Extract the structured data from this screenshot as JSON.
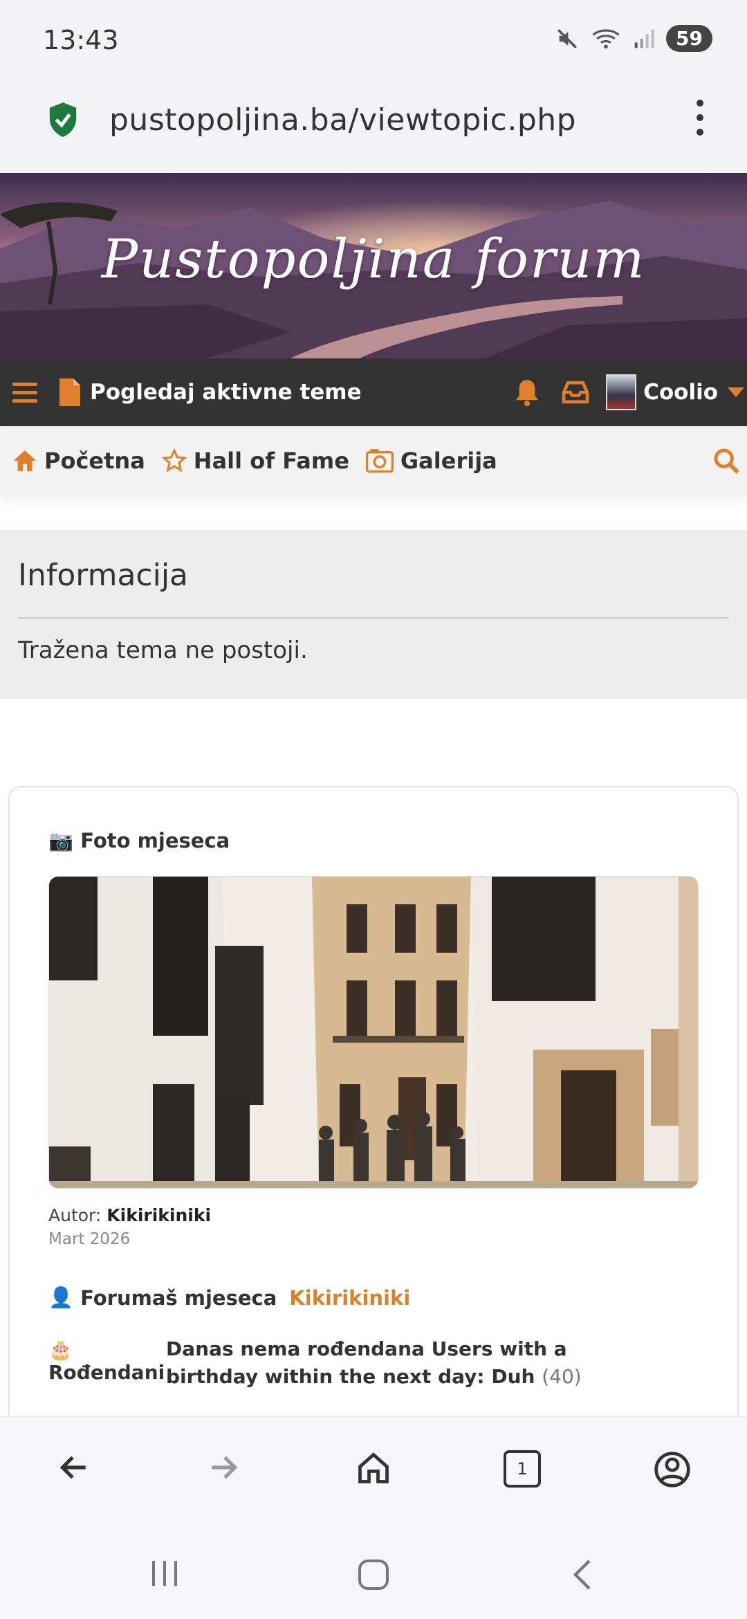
{
  "status_bar": {
    "time": "13:43",
    "battery": "59"
  },
  "url_bar": {
    "url": "pustopoljina.ba/viewtopic.php"
  },
  "banner": {
    "title": "Pustopoljina forum"
  },
  "navbar": {
    "active_topics": "Pogledaj aktivne teme",
    "username": "Coolio"
  },
  "subnav": {
    "items": [
      "Početna",
      "Hall of Fame",
      "Galerija"
    ]
  },
  "info": {
    "title": "Informacija",
    "message": "Tražena tema ne postoji."
  },
  "card": {
    "photo_heading": "Foto mjeseca",
    "author_label": "Autor:",
    "author": "Kikirikiniki",
    "date": "Mart 2026",
    "member_heading": "Forumaš mjeseca",
    "member_name": "Kikirikiniki",
    "birthday_label": "Rođendani",
    "birthday_text": "Danas nema rođendana Users with a birthday within the next day: Duh",
    "birthday_age": "(40)"
  },
  "browser_bar": {
    "tab_count": "1"
  },
  "colors": {
    "accent": "#e0802c",
    "navbar_bg": "#333333",
    "secure_green": "#1e7a3c"
  },
  "icons": {
    "shield": "shield-check-icon",
    "menu": "hamburger-icon",
    "doc": "document-icon",
    "bell": "bell-icon",
    "inbox": "inbox-icon",
    "home": "home-icon",
    "star": "star-icon",
    "camera": "camera-icon",
    "search": "search-icon",
    "person": "person-icon",
    "cake": "cake-icon"
  }
}
